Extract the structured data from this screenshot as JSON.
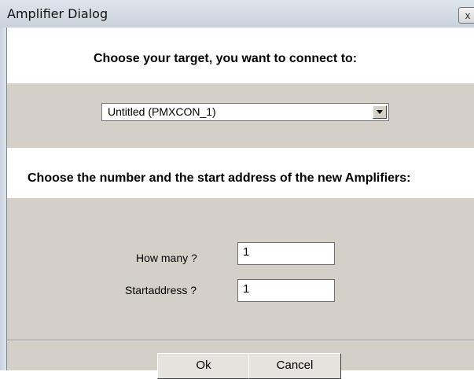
{
  "window": {
    "title": "Amplifier Dialog",
    "close_glyph": "x"
  },
  "target": {
    "heading": "Choose your target, you want to connect to:",
    "dropdown_value": "Untitled (PMXCON_1)"
  },
  "amplifiers": {
    "heading": "Choose the number and the start address of the new Amplifiers:",
    "how_many_label": "How many ?",
    "how_many_value": "1",
    "startaddress_label": "Startaddress ?",
    "startaddress_value": "1"
  },
  "buttons": {
    "ok": "Ok",
    "cancel": "Cancel"
  }
}
